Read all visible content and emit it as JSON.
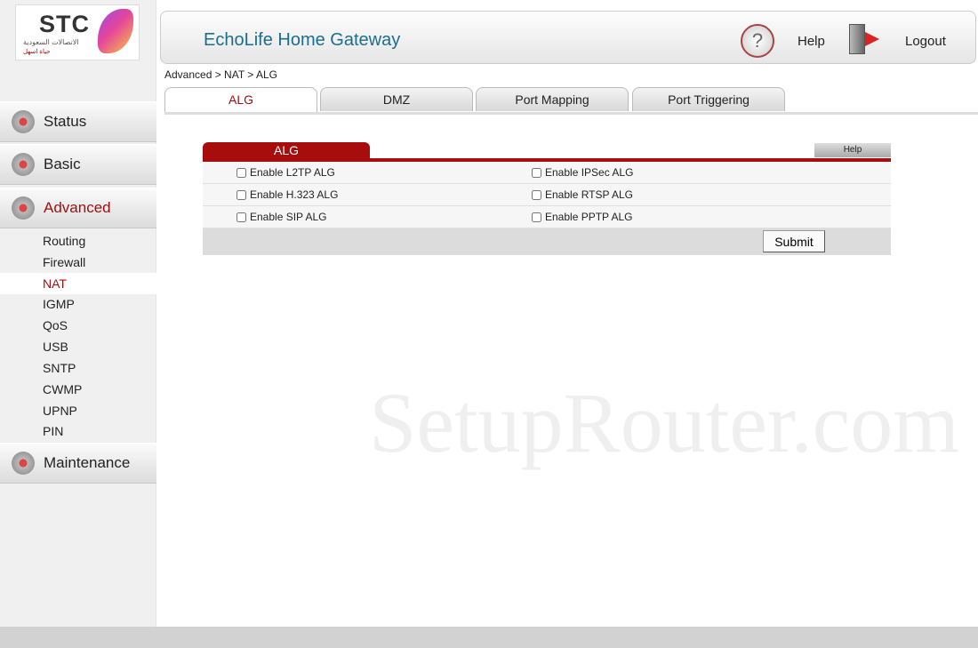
{
  "logo": {
    "brand": "STC",
    "arabic_line1": "الاتصالات السعودية",
    "arabic_line2": "حياة اسهل"
  },
  "header": {
    "title": "EchoLife Home Gateway",
    "help_label": "Help",
    "logout_label": "Logout"
  },
  "breadcrumb": "Advanced > NAT > ALG",
  "sidebar": {
    "items": [
      {
        "label": "Status",
        "icon": "status-icon"
      },
      {
        "label": "Basic",
        "icon": "gear-icon"
      },
      {
        "label": "Advanced",
        "icon": "advanced-icon",
        "active": true
      },
      {
        "label": "Maintenance",
        "icon": "maintenance-icon"
      }
    ],
    "subitems": [
      "Routing",
      "Firewall",
      "NAT",
      "IGMP",
      "QoS",
      "USB",
      "SNTP",
      "CWMP",
      "UPNP",
      "PIN"
    ],
    "active_sub": "NAT"
  },
  "tabs": [
    "ALG",
    "DMZ",
    "Port Mapping",
    "Port Triggering"
  ],
  "active_tab": "ALG",
  "panel": {
    "title": "ALG",
    "help": "Help",
    "options": [
      {
        "label": "Enable L2TP ALG",
        "checked": false
      },
      {
        "label": "Enable IPSec ALG",
        "checked": false
      },
      {
        "label": "Enable H.323 ALG",
        "checked": false
      },
      {
        "label": "Enable RTSP ALG",
        "checked": false
      },
      {
        "label": "Enable SIP ALG",
        "checked": false
      },
      {
        "label": "Enable PPTP ALG",
        "checked": false
      }
    ],
    "submit": "Submit"
  },
  "watermark": "SetupRouter.com",
  "colors": {
    "accent": "#a80d0d",
    "title": "#1b6e8c"
  }
}
